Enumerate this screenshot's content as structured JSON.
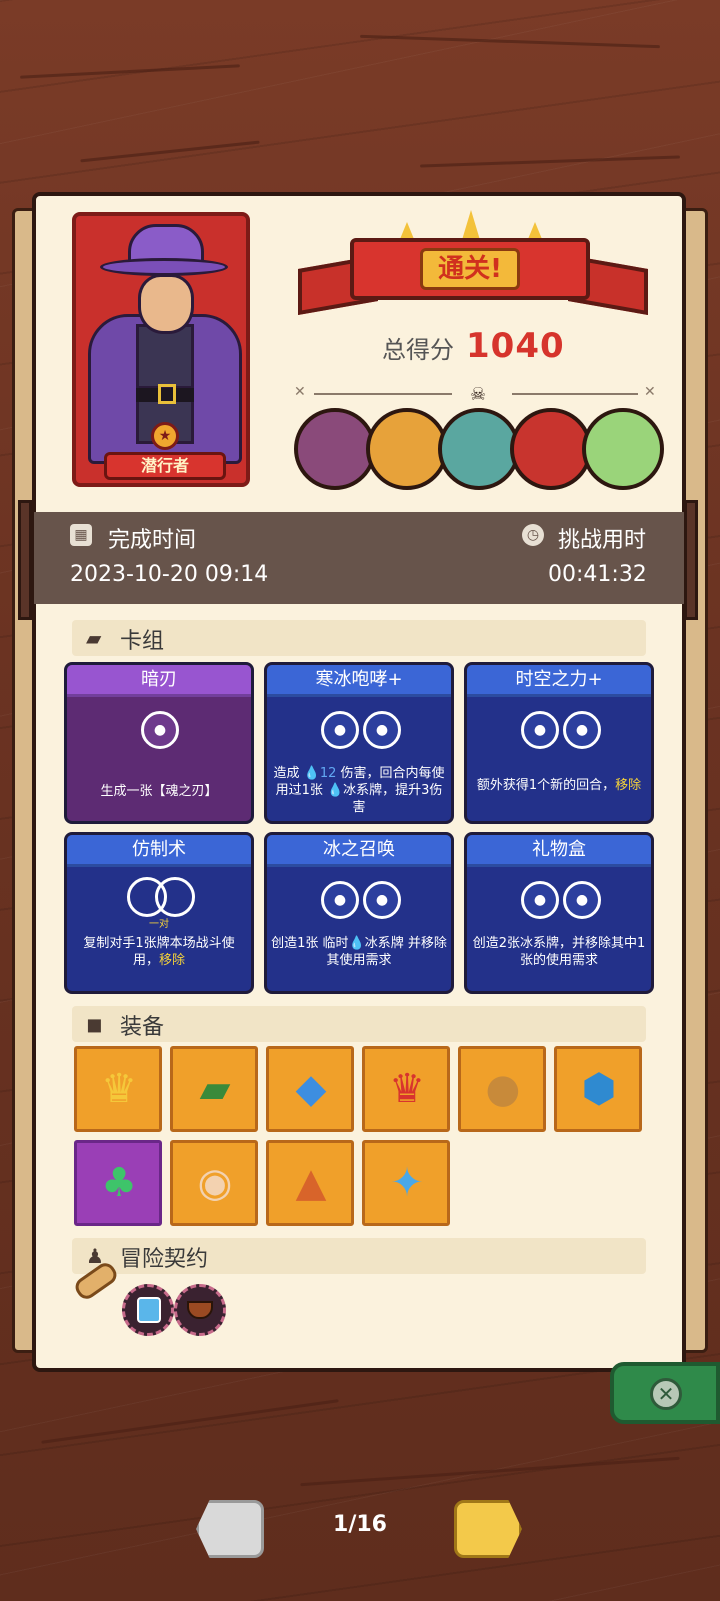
{
  "character": {
    "name": "潜行者",
    "badge_icon": "star-emblem-icon"
  },
  "result": {
    "banner": "通关!",
    "score_label": "总得分",
    "score_value": "1040"
  },
  "bosses": [
    {
      "name": "pink-golem",
      "color": "#8a4a7a"
    },
    {
      "name": "golden-warrior",
      "color": "#e7a23a"
    },
    {
      "name": "dragon-bird",
      "color": "#5aa7a0"
    },
    {
      "name": "red-demon",
      "color": "#c8342e"
    },
    {
      "name": "forest-elf",
      "color": "#9ad47a"
    }
  ],
  "time": {
    "complete_label": "完成时间",
    "complete_value": "2023-10-20 09:14",
    "challenge_label": "挑战用时",
    "challenge_value": "00:41:32"
  },
  "sections": {
    "deck": "卡组",
    "equipment": "装备",
    "contract": "冒险契约"
  },
  "cards": [
    {
      "title": "暗刃",
      "style": "purple",
      "desc_parts": [
        "生成一张【魂之刃】"
      ]
    },
    {
      "title": "寒冰咆哮+",
      "style": "blue",
      "desc_a": "造成 ",
      "desc_num": "12",
      "desc_b": " 伤害，回合内每使用过1张 ",
      "desc_c": "冰系牌，提升3伤害"
    },
    {
      "title": "时空之力+",
      "style": "blue",
      "desc_a": "额外获得1个新的回合，",
      "desc_hi": "移除"
    },
    {
      "title": "仿制术",
      "style": "blue",
      "tag": "一对",
      "desc_a": "复制对手1张牌本场战斗使用，",
      "desc_hi": "移除"
    },
    {
      "title": "冰之召唤",
      "style": "blue",
      "desc_a": "创造1张 临时",
      "desc_b": "冰系牌 并移除其使用需求"
    },
    {
      "title": "礼物盒",
      "style": "blue",
      "desc_a": "创造2张冰系牌，并移除其中1张的使用需求"
    }
  ],
  "equipment_icons": [
    "crown-icon",
    "moss-stone-icon",
    "blue-crystal-icon",
    "red-crown-icon",
    "treasure-bag-icon",
    "ice-shield-icon",
    "clover-icon",
    "donut-icon",
    "sweater-icon",
    "ice-sword-icon"
  ],
  "contracts": [
    "scroll-icon",
    "frozen-book-icon",
    "pipe-icon"
  ],
  "pagination": {
    "current": "1/16"
  }
}
